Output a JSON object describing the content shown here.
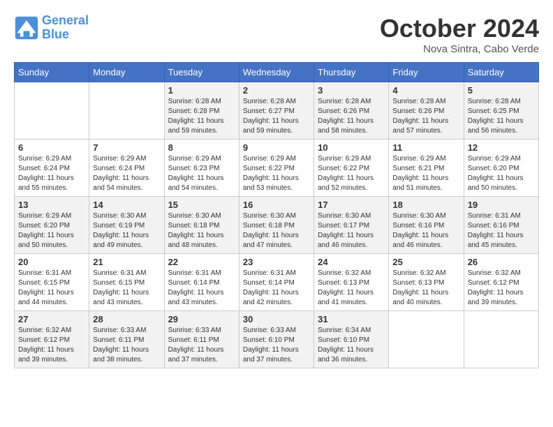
{
  "header": {
    "logo_line1": "General",
    "logo_line2": "Blue",
    "month": "October 2024",
    "location": "Nova Sintra, Cabo Verde"
  },
  "weekdays": [
    "Sunday",
    "Monday",
    "Tuesday",
    "Wednesday",
    "Thursday",
    "Friday",
    "Saturday"
  ],
  "weeks": [
    [
      {
        "day": "",
        "info": ""
      },
      {
        "day": "",
        "info": ""
      },
      {
        "day": "1",
        "info": "Sunrise: 6:28 AM\nSunset: 6:28 PM\nDaylight: 11 hours and 59 minutes."
      },
      {
        "day": "2",
        "info": "Sunrise: 6:28 AM\nSunset: 6:27 PM\nDaylight: 11 hours and 59 minutes."
      },
      {
        "day": "3",
        "info": "Sunrise: 6:28 AM\nSunset: 6:26 PM\nDaylight: 11 hours and 58 minutes."
      },
      {
        "day": "4",
        "info": "Sunrise: 6:28 AM\nSunset: 6:26 PM\nDaylight: 11 hours and 57 minutes."
      },
      {
        "day": "5",
        "info": "Sunrise: 6:28 AM\nSunset: 6:25 PM\nDaylight: 11 hours and 56 minutes."
      }
    ],
    [
      {
        "day": "6",
        "info": "Sunrise: 6:29 AM\nSunset: 6:24 PM\nDaylight: 11 hours and 55 minutes."
      },
      {
        "day": "7",
        "info": "Sunrise: 6:29 AM\nSunset: 6:24 PM\nDaylight: 11 hours and 54 minutes."
      },
      {
        "day": "8",
        "info": "Sunrise: 6:29 AM\nSunset: 6:23 PM\nDaylight: 11 hours and 54 minutes."
      },
      {
        "day": "9",
        "info": "Sunrise: 6:29 AM\nSunset: 6:22 PM\nDaylight: 11 hours and 53 minutes."
      },
      {
        "day": "10",
        "info": "Sunrise: 6:29 AM\nSunset: 6:22 PM\nDaylight: 11 hours and 52 minutes."
      },
      {
        "day": "11",
        "info": "Sunrise: 6:29 AM\nSunset: 6:21 PM\nDaylight: 11 hours and 51 minutes."
      },
      {
        "day": "12",
        "info": "Sunrise: 6:29 AM\nSunset: 6:20 PM\nDaylight: 11 hours and 50 minutes."
      }
    ],
    [
      {
        "day": "13",
        "info": "Sunrise: 6:29 AM\nSunset: 6:20 PM\nDaylight: 11 hours and 50 minutes."
      },
      {
        "day": "14",
        "info": "Sunrise: 6:30 AM\nSunset: 6:19 PM\nDaylight: 11 hours and 49 minutes."
      },
      {
        "day": "15",
        "info": "Sunrise: 6:30 AM\nSunset: 6:18 PM\nDaylight: 11 hours and 48 minutes."
      },
      {
        "day": "16",
        "info": "Sunrise: 6:30 AM\nSunset: 6:18 PM\nDaylight: 11 hours and 47 minutes."
      },
      {
        "day": "17",
        "info": "Sunrise: 6:30 AM\nSunset: 6:17 PM\nDaylight: 11 hours and 46 minutes."
      },
      {
        "day": "18",
        "info": "Sunrise: 6:30 AM\nSunset: 6:16 PM\nDaylight: 11 hours and 46 minutes."
      },
      {
        "day": "19",
        "info": "Sunrise: 6:31 AM\nSunset: 6:16 PM\nDaylight: 11 hours and 45 minutes."
      }
    ],
    [
      {
        "day": "20",
        "info": "Sunrise: 6:31 AM\nSunset: 6:15 PM\nDaylight: 11 hours and 44 minutes."
      },
      {
        "day": "21",
        "info": "Sunrise: 6:31 AM\nSunset: 6:15 PM\nDaylight: 11 hours and 43 minutes."
      },
      {
        "day": "22",
        "info": "Sunrise: 6:31 AM\nSunset: 6:14 PM\nDaylight: 11 hours and 43 minutes."
      },
      {
        "day": "23",
        "info": "Sunrise: 6:31 AM\nSunset: 6:14 PM\nDaylight: 11 hours and 42 minutes."
      },
      {
        "day": "24",
        "info": "Sunrise: 6:32 AM\nSunset: 6:13 PM\nDaylight: 11 hours and 41 minutes."
      },
      {
        "day": "25",
        "info": "Sunrise: 6:32 AM\nSunset: 6:13 PM\nDaylight: 11 hours and 40 minutes."
      },
      {
        "day": "26",
        "info": "Sunrise: 6:32 AM\nSunset: 6:12 PM\nDaylight: 11 hours and 39 minutes."
      }
    ],
    [
      {
        "day": "27",
        "info": "Sunrise: 6:32 AM\nSunset: 6:12 PM\nDaylight: 11 hours and 39 minutes."
      },
      {
        "day": "28",
        "info": "Sunrise: 6:33 AM\nSunset: 6:11 PM\nDaylight: 11 hours and 38 minutes."
      },
      {
        "day": "29",
        "info": "Sunrise: 6:33 AM\nSunset: 6:11 PM\nDaylight: 11 hours and 37 minutes."
      },
      {
        "day": "30",
        "info": "Sunrise: 6:33 AM\nSunset: 6:10 PM\nDaylight: 11 hours and 37 minutes."
      },
      {
        "day": "31",
        "info": "Sunrise: 6:34 AM\nSunset: 6:10 PM\nDaylight: 11 hours and 36 minutes."
      },
      {
        "day": "",
        "info": ""
      },
      {
        "day": "",
        "info": ""
      }
    ]
  ]
}
